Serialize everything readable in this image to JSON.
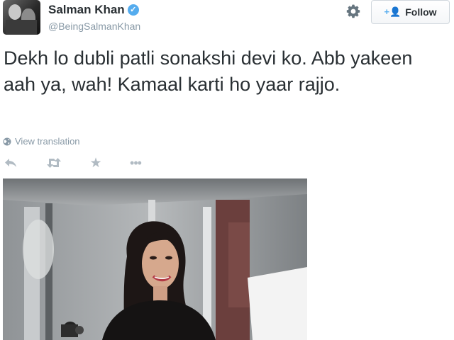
{
  "author": {
    "name": "Salman Khan",
    "handle": "@BeingSalmanKhan",
    "verified_icon": "verified-badge-icon"
  },
  "header": {
    "gear_icon": "gear-icon",
    "follow_label": "Follow",
    "follow_icon": "add-person-icon"
  },
  "tweet": {
    "text": "Dekh lo dubli patli sonakshi devi ko. Abb yakeen aah ya, wah! Kamaal karti ho yaar rajjo.",
    "translate_label": "View translation"
  },
  "actions": {
    "reply_icon": "reply-icon",
    "retweet_icon": "retweet-icon",
    "favorite_icon": "star-icon",
    "more_icon": "more-icon"
  },
  "colors": {
    "accent": "#55acee",
    "text": "#292f33",
    "muted": "#8899a6",
    "icon": "#b1bbc3"
  }
}
